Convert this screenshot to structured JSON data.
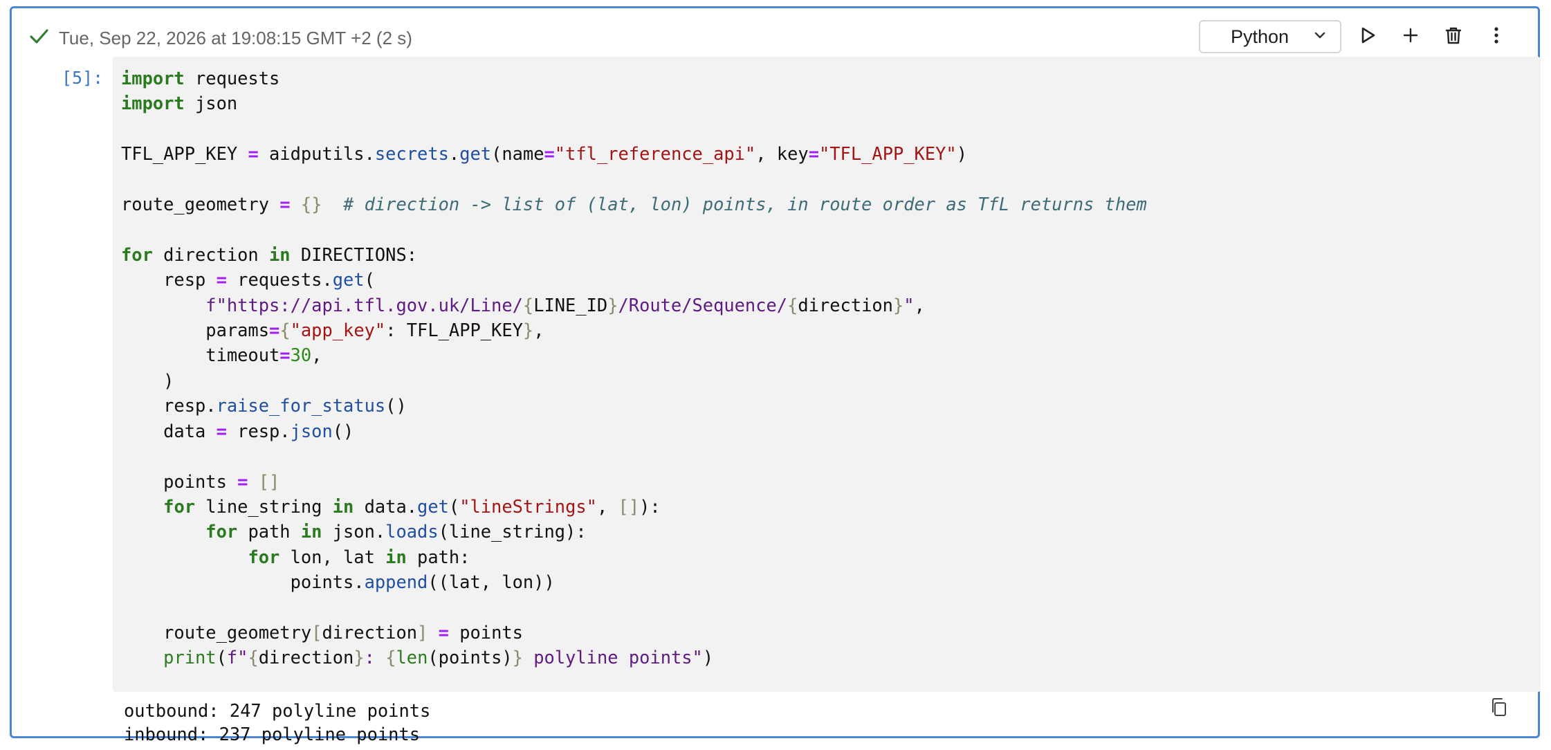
{
  "status": {
    "check_icon": "check-icon",
    "timestamp": "Tue, Sep 22, 2026 at 19:08:15 GMT +2 (2 s)"
  },
  "toolbar": {
    "kernel": "Python",
    "icons": [
      "chevron-down-icon",
      "play-icon",
      "plus-icon",
      "trash-icon",
      "more-vert-icon"
    ]
  },
  "cell": {
    "prompt": "[5]:",
    "code_lines": [
      "import requests",
      "import json",
      "",
      "TFL_APP_KEY = aidputils.secrets.get(name=\"tfl_reference_api\", key=\"TFL_APP_KEY\")",
      "",
      "route_geometry = {}  # direction -> list of (lat, lon) points, in route order as TfL returns them",
      "",
      "for direction in DIRECTIONS:",
      "    resp = requests.get(",
      "        f\"https://api.tfl.gov.uk/Line/{LINE_ID}/Route/Sequence/{direction}\",",
      "        params={\"app_key\": TFL_APP_KEY},",
      "        timeout=30,",
      "    )",
      "    resp.raise_for_status()",
      "    data = resp.json()",
      "",
      "    points = []",
      "    for line_string in data.get(\"lineStrings\", []):",
      "        for path in json.loads(line_string):",
      "            for lon, lat in path:",
      "                points.append((lat, lon))",
      "",
      "    route_geometry[direction] = points",
      "    print(f\"{direction}: {len(points)} polyline points\")"
    ],
    "output_lines": [
      "outbound: 247 polyline points",
      "inbound: 237 polyline points"
    ],
    "copy_icon": "copy-icon"
  },
  "colors": {
    "accent": "#4a86d6",
    "keyword": "#2a7a1f",
    "operator": "#a020f0",
    "string": "#a31515",
    "function": "#1f4fa0",
    "comment": "#3d6b76"
  }
}
